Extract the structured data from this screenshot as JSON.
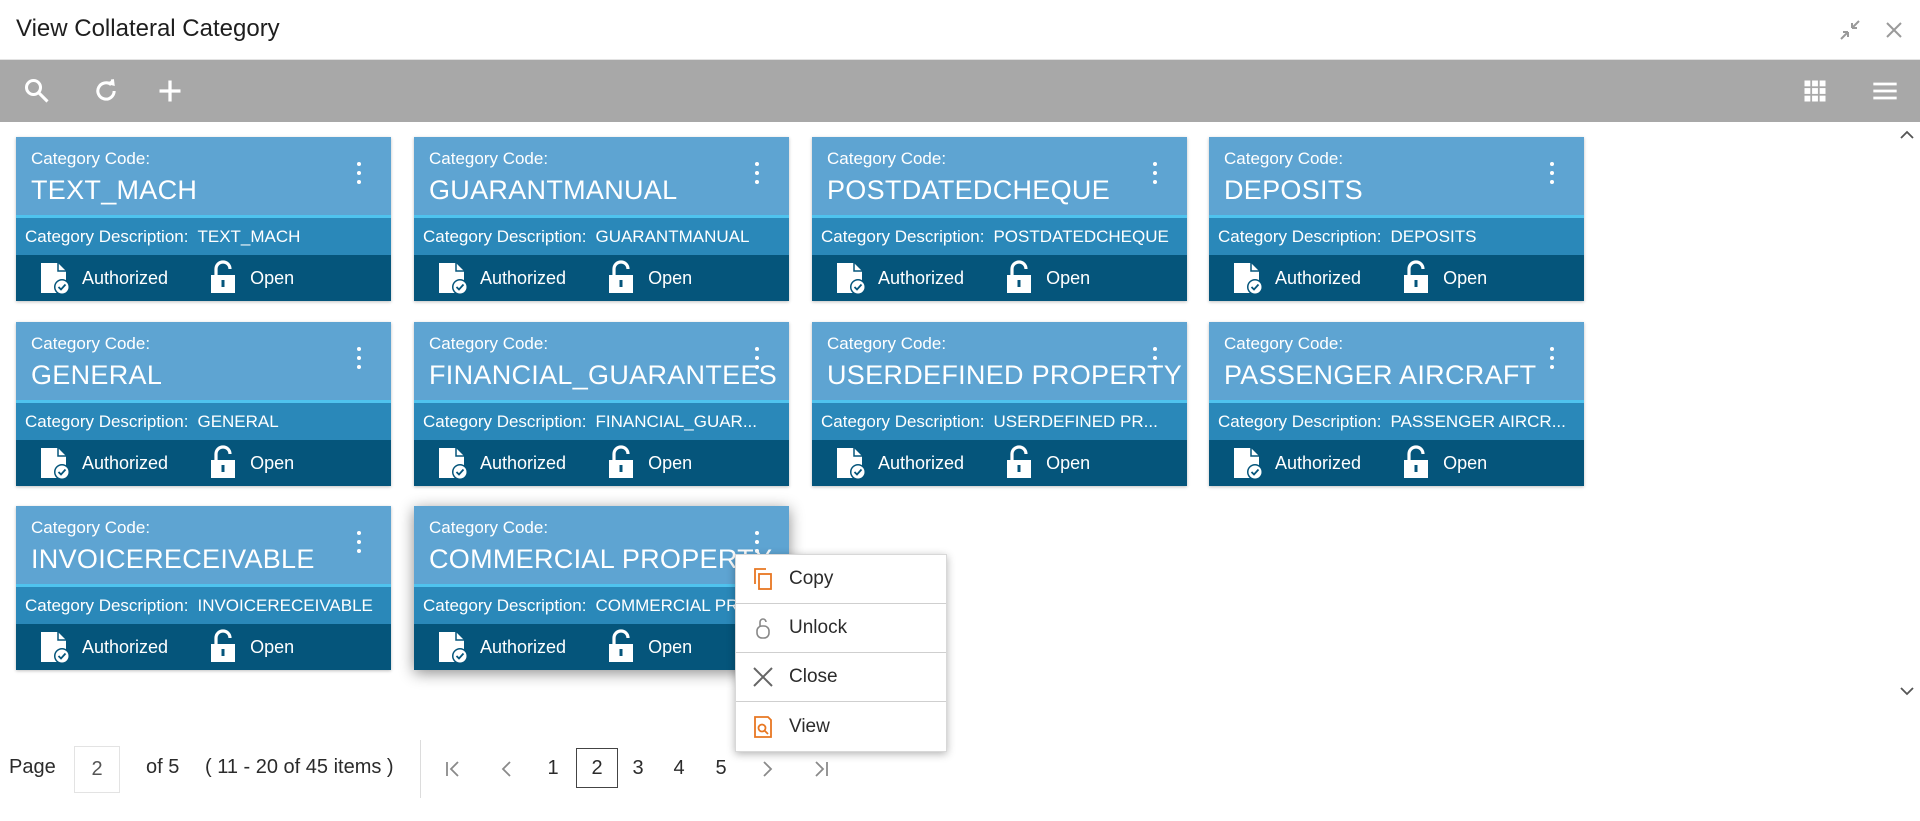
{
  "window": {
    "title": "View Collateral Category"
  },
  "icons": {
    "toolbar": [
      "search-icon",
      "refresh-icon",
      "add-icon",
      "grid-view-icon",
      "list-view-icon"
    ],
    "window": [
      "minimize-icon",
      "close-icon"
    ],
    "status": [
      "authorized-icon",
      "unlock-icon"
    ]
  },
  "colors": {
    "card_top": "#5ea4d2",
    "card_desc": "#2a88b9",
    "card_status": "#05557b",
    "accent_line": "#4fc3ee",
    "toolbar": "#a8a8a8",
    "menu_icon": "#e87722"
  },
  "cards": [
    {
      "code_label": "Category Code:",
      "code": "TEXT_MACH",
      "desc_label": "Category Description:",
      "desc": "TEXT_MACH",
      "auth": "Authorized",
      "lock": "Open"
    },
    {
      "code_label": "Category Code:",
      "code": "GUARANTMANUAL",
      "desc_label": "Category Description:",
      "desc": "GUARANTMANUAL",
      "auth": "Authorized",
      "lock": "Open"
    },
    {
      "code_label": "Category Code:",
      "code": "POSTDATEDCHEQUE",
      "desc_label": "Category Description:",
      "desc": "POSTDATEDCHEQUE",
      "auth": "Authorized",
      "lock": "Open"
    },
    {
      "code_label": "Category Code:",
      "code": "DEPOSITS",
      "desc_label": "Category Description:",
      "desc": "DEPOSITS",
      "auth": "Authorized",
      "lock": "Open"
    },
    {
      "code_label": "Category Code:",
      "code": "GENERAL",
      "desc_label": "Category Description:",
      "desc": "GENERAL",
      "auth": "Authorized",
      "lock": "Open"
    },
    {
      "code_label": "Category Code:",
      "code": "FINANCIAL_GUARANTEES",
      "desc_label": "Category Description:",
      "desc": "FINANCIAL_GUAR...",
      "auth": "Authorized",
      "lock": "Open"
    },
    {
      "code_label": "Category Code:",
      "code": "USERDEFINED PROPERTY",
      "desc_label": "Category Description:",
      "desc": "USERDEFINED PR...",
      "auth": "Authorized",
      "lock": "Open"
    },
    {
      "code_label": "Category Code:",
      "code": "PASSENGER AIRCRAFT",
      "desc_label": "Category Description:",
      "desc": "PASSENGER AIRCR...",
      "auth": "Authorized",
      "lock": "Open"
    },
    {
      "code_label": "Category Code:",
      "code": "INVOICERECEIVABLE",
      "desc_label": "Category Description:",
      "desc": "INVOICERECEIVABLE",
      "auth": "Authorized",
      "lock": "Open"
    },
    {
      "code_label": "Category Code:",
      "code": "COMMERCIAL PROPERTY",
      "desc_label": "Category Description:",
      "desc": "COMMERCIAL PR",
      "auth": "Authorized",
      "lock": "Open"
    }
  ],
  "context_menu": {
    "items": [
      {
        "label": "Copy",
        "icon": "copy-icon"
      },
      {
        "label": "Unlock",
        "icon": "unlock-icon"
      },
      {
        "label": "Close",
        "icon": "close-icon"
      },
      {
        "label": "View",
        "icon": "view-icon"
      }
    ]
  },
  "pagination": {
    "page_label": "Page",
    "current_page": "2",
    "of_text": "of 5",
    "items_text": "( 11 - 20 of 45 items )",
    "pages": [
      "1",
      "2",
      "3",
      "4",
      "5"
    ],
    "active_page": "2"
  }
}
